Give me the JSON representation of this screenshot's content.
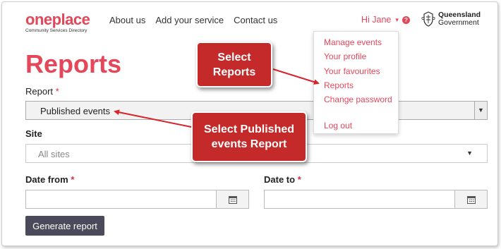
{
  "header": {
    "logo_main": "oneplace",
    "logo_sub": "Community Services Directory",
    "nav": [
      "About us",
      "Add your service",
      "Contact us"
    ],
    "user_label": "Hi Jane",
    "user_caret": "▾",
    "help_symbol": "?",
    "gov_line1": "Queensland",
    "gov_line2": "Government"
  },
  "page": {
    "title": "Reports",
    "report_label": "Report",
    "report_required": "*",
    "report_value": "Published events",
    "site_label": "Site",
    "site_placeholder": "All sites",
    "date_from_label": "Date from",
    "date_from_required": "*",
    "date_to_label": "Date to",
    "date_to_required": "*",
    "generate_button": "Generate report"
  },
  "user_menu": {
    "items": [
      "Manage events",
      "Your profile",
      "Your favourites",
      "Reports",
      "Change password",
      "Log out"
    ]
  },
  "callouts": {
    "select_reports_line1": "Select",
    "select_reports_line2": "Reports",
    "select_published_line1": "Select Published",
    "select_published_line2": "events Report"
  },
  "colors": {
    "brand": "#e4475a",
    "callout": "#c42a2a",
    "button": "#4a4a5a"
  }
}
